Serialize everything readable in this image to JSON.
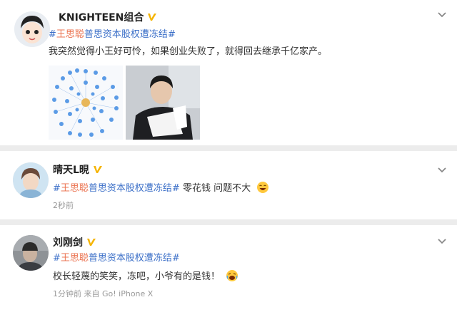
{
  "posts": [
    {
      "author": "KNIGHTEEN组合",
      "topic": {
        "hash_open": "#",
        "highlight": "王思聪",
        "rest": "普思资本股权遭冻结",
        "hash_close": "#"
      },
      "text": "我突然觉得小王好可怜，如果创业失败了，就得回去继承千亿家产。",
      "images": [
        "network-graph-image",
        "man-reading-document-photo"
      ]
    },
    {
      "author": "晴天L晛",
      "topic": {
        "hash_open": "#",
        "highlight": "王思聪",
        "rest": "普思资本股权遭冻结",
        "hash_close": "#"
      },
      "text": "零花钱 问题不大",
      "emoji": "laughing-emoji",
      "meta": "2秒前"
    },
    {
      "author": "刘刚剑",
      "topic": {
        "hash_open": "#",
        "highlight": "王思聪",
        "rest": "普思资本股权遭冻结",
        "hash_close": "#"
      },
      "text": "校长轻蔑的笑笑，冻吧，小爷有的是钱！",
      "emoji": "laugh-cry-emoji",
      "meta": "1分钟前  来自 Go! iPhone X"
    }
  ],
  "colors": {
    "topic_highlight": "#eb7350",
    "topic_text": "#3b6fc8",
    "meta": "#999999",
    "badge": "#f5b400"
  }
}
